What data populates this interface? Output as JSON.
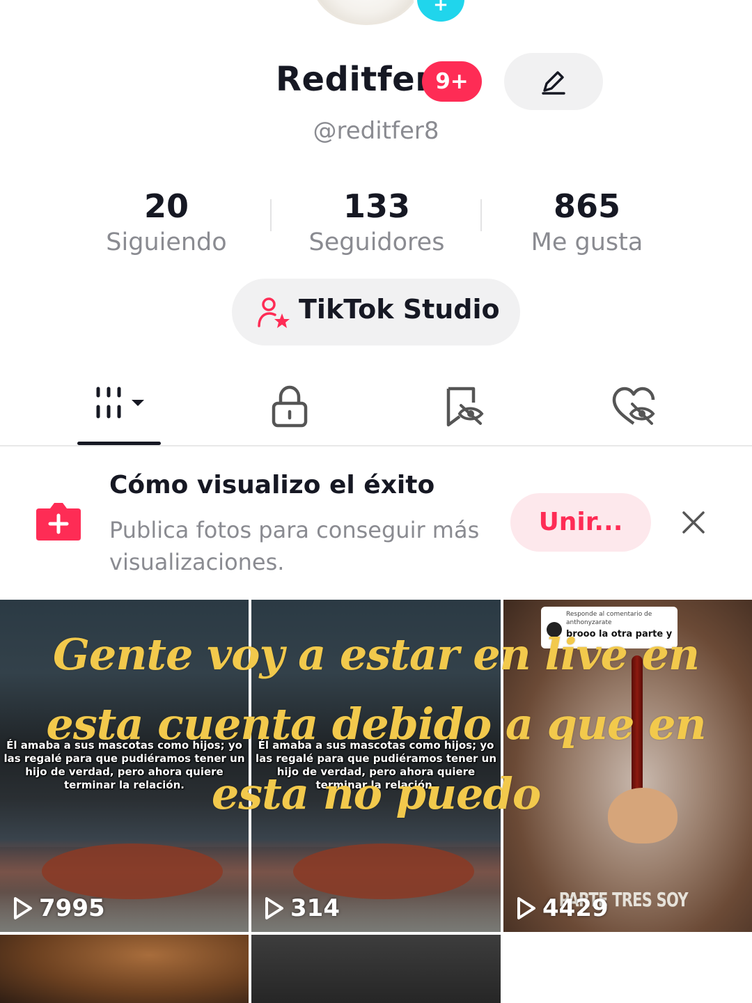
{
  "profile": {
    "name": "Reditfer",
    "badge": "9+",
    "username": "@reditfer8"
  },
  "stats": [
    {
      "value": "20",
      "label": "Siguiendo"
    },
    {
      "value": "133",
      "label": "Seguidores"
    },
    {
      "value": "865",
      "label": "Me gusta"
    }
  ],
  "studio": {
    "label": "TikTok Studio"
  },
  "tabs": [
    {
      "icon": "grid-icon",
      "active": true
    },
    {
      "icon": "lock-icon"
    },
    {
      "icon": "bookmark-hidden-icon"
    },
    {
      "icon": "heart-hidden-icon"
    }
  ],
  "promo": {
    "title": "Cómo visualizo el éxito",
    "description": "Publica fotos para conseguir más visualizaciones.",
    "join_label": "Unir..."
  },
  "videos": [
    {
      "views": "7995",
      "overlay": "Él amaba a sus mascotas como hijos; yo las regalé para que pudiéramos tener un hijo de verdad, pero ahora quiere terminar la relación."
    },
    {
      "views": "314",
      "overlay": "Él amaba a sus mascotas como hijos; yo las regalé para que pudiéramos tener un hijo de verdad, pero ahora quiere terminar la relación."
    },
    {
      "views": "4429",
      "comment_line1": "Responde al comentario de",
      "comment_line2": "anthonyzarate",
      "comment_line3": "brooo la otra parte y",
      "corner_text": "PARTE TRES SOY"
    }
  ],
  "caption": "Gente voy a estar en live en esta cuenta debido a que en esta no puedo",
  "colors": {
    "accent": "#fe2c55",
    "caption": "#f2c94c",
    "avatar_add": "#20d5ec"
  }
}
